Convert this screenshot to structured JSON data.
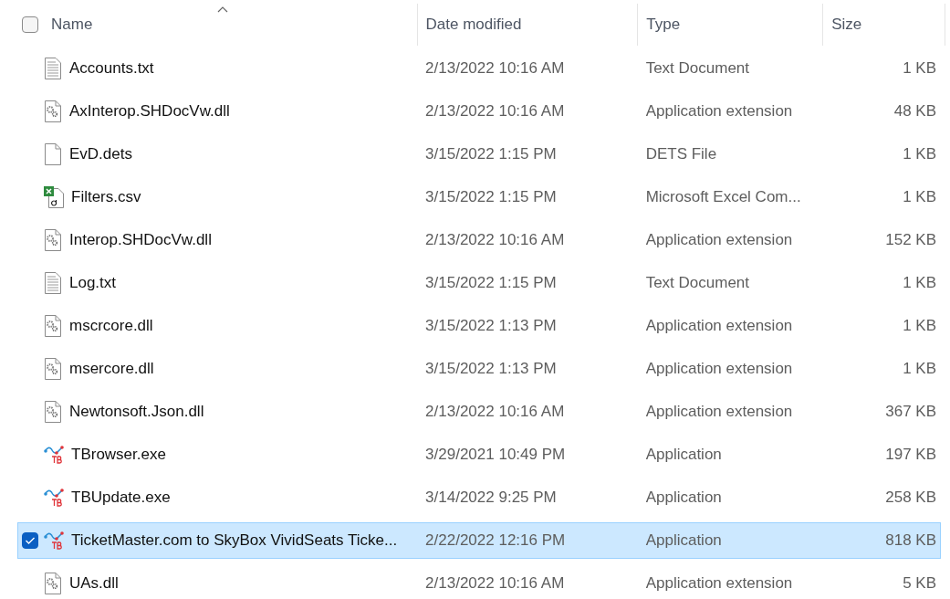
{
  "header": {
    "select_all_checked": false,
    "columns": [
      {
        "label": "Name",
        "sorted": true
      },
      {
        "label": "Date modified",
        "sorted": false
      },
      {
        "label": "Type",
        "sorted": false
      },
      {
        "label": "Size",
        "sorted": false
      }
    ]
  },
  "files": [
    {
      "name": "Accounts.txt",
      "date": "2/13/2022 10:16 AM",
      "type": "Text Document",
      "size": "1 KB",
      "kind": "text",
      "selected": false
    },
    {
      "name": "AxInterop.SHDocVw.dll",
      "date": "2/13/2022 10:16 AM",
      "type": "Application extension",
      "size": "48 KB",
      "kind": "dll",
      "selected": false
    },
    {
      "name": "EvD.dets",
      "date": "3/15/2022 1:15 PM",
      "type": "DETS File",
      "size": "1 KB",
      "kind": "blank",
      "selected": false
    },
    {
      "name": "Filters.csv",
      "date": "3/15/2022 1:15 PM",
      "type": "Microsoft Excel Com...",
      "size": "1 KB",
      "kind": "excel",
      "selected": false
    },
    {
      "name": "Interop.SHDocVw.dll",
      "date": "2/13/2022 10:16 AM",
      "type": "Application extension",
      "size": "152 KB",
      "kind": "dll",
      "selected": false
    },
    {
      "name": "Log.txt",
      "date": "3/15/2022 1:15 PM",
      "type": "Text Document",
      "size": "1 KB",
      "kind": "text",
      "selected": false
    },
    {
      "name": "mscrcore.dll",
      "date": "3/15/2022 1:13 PM",
      "type": "Application extension",
      "size": "1 KB",
      "kind": "dll",
      "selected": false
    },
    {
      "name": "msercore.dll",
      "date": "3/15/2022 1:13 PM",
      "type": "Application extension",
      "size": "1 KB",
      "kind": "dll",
      "selected": false
    },
    {
      "name": "Newtonsoft.Json.dll",
      "date": "2/13/2022 10:16 AM",
      "type": "Application extension",
      "size": "367 KB",
      "kind": "dll",
      "selected": false
    },
    {
      "name": "TBrowser.exe",
      "date": "3/29/2021 10:49 PM",
      "type": "Application",
      "size": "197 KB",
      "kind": "app",
      "selected": false
    },
    {
      "name": "TBUpdate.exe",
      "date": "3/14/2022 9:25 PM",
      "type": "Application",
      "size": "258 KB",
      "kind": "app",
      "selected": false
    },
    {
      "name": "TicketMaster.com to SkyBox VividSeats Ticke...",
      "date": "2/22/2022 12:16 PM",
      "type": "Application",
      "size": "818 KB",
      "kind": "app",
      "selected": true
    },
    {
      "name": "UAs.dll",
      "date": "2/13/2022 10:16 AM",
      "type": "Application extension",
      "size": "5 KB",
      "kind": "dll",
      "selected": false
    }
  ]
}
